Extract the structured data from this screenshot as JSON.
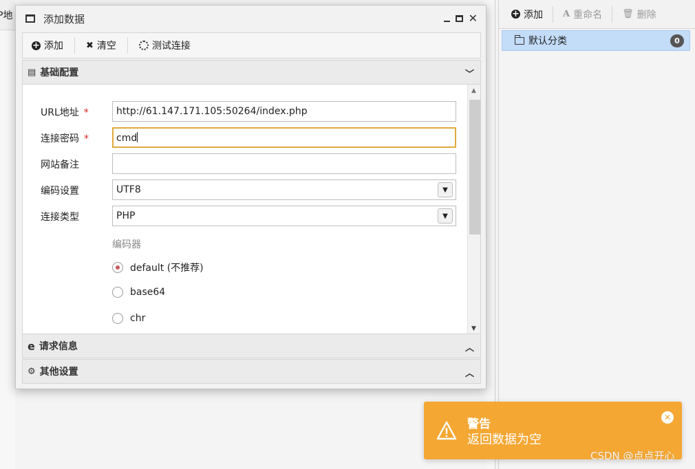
{
  "background": {
    "left_header_text": "P地"
  },
  "right_panel": {
    "toolbar": {
      "add": "添加",
      "rename": "重命名",
      "delete": "删除"
    },
    "categories": [
      {
        "label": "默认分类",
        "count": "0"
      }
    ]
  },
  "window": {
    "title": "添加数据",
    "toolbar": {
      "add": "添加",
      "clear": "清空",
      "test": "测试连接"
    },
    "sections": {
      "basic": "基础配置",
      "request": "请求信息",
      "other": "其他设置"
    },
    "form": {
      "url_label": "URL地址",
      "url_value": "http://61.147.171.105:50264/index.php",
      "password_label": "连接密码",
      "password_value": "cmd",
      "note_label": "网站备注",
      "note_value": "",
      "encoding_label": "编码设置",
      "encoding_value": "UTF8",
      "type_label": "连接类型",
      "type_value": "PHP",
      "required_mark": "*",
      "encoder_label": "编码器",
      "encoders": [
        {
          "label": "default (不推荐)",
          "checked": true
        },
        {
          "label": "base64",
          "checked": false
        },
        {
          "label": "chr",
          "checked": false
        }
      ]
    }
  },
  "toast": {
    "title": "警告",
    "message": "返回数据为空",
    "color": "#f5a733"
  },
  "watermark": "CSDN @点点开心"
}
